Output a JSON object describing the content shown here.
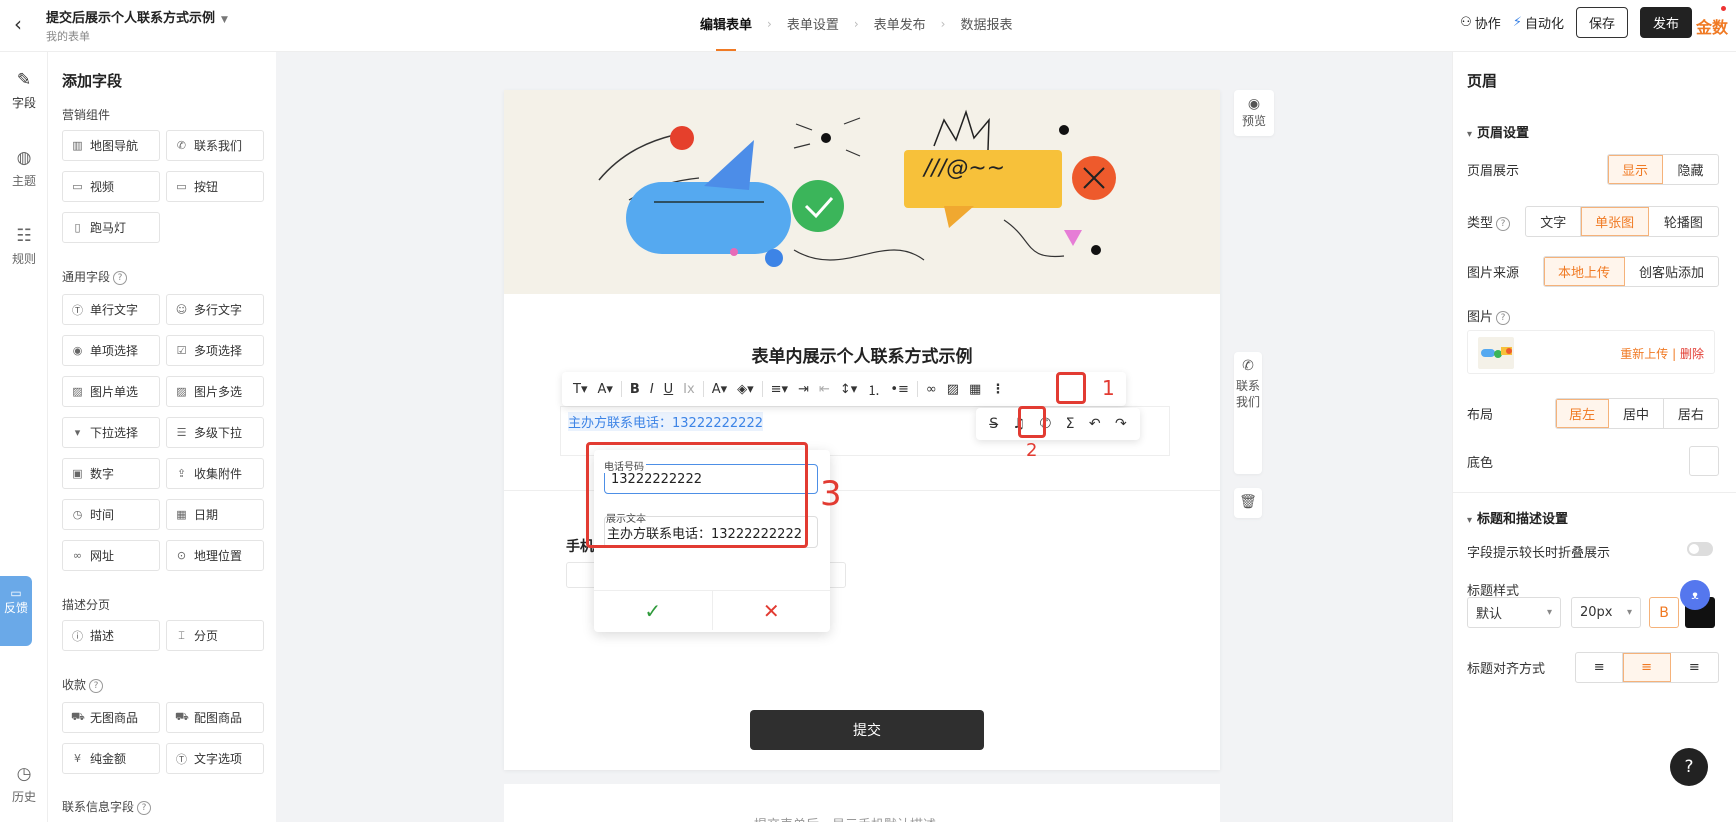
{
  "header": {
    "title": "提交后展示个人联系方式示例",
    "subtitle": "我的表单",
    "steps": [
      "编辑表单",
      "表单设置",
      "表单发布",
      "数据报表"
    ],
    "collab": "协作",
    "automation": "自动化",
    "save": "保存",
    "publish": "发布",
    "brand": "金数"
  },
  "left_nav": {
    "fields": "字段",
    "theme": "主题",
    "rules": "规则",
    "history": "历史",
    "feedback": "反馈"
  },
  "field_panel": {
    "title": "添加字段",
    "groups": [
      {
        "name": "营销组件",
        "items": [
          {
            "icon": "map-icon",
            "label": "地图导航"
          },
          {
            "icon": "phone-icon",
            "label": "联系我们"
          },
          {
            "icon": "video-icon",
            "label": "视频"
          },
          {
            "icon": "button-icon",
            "label": "按钮"
          },
          {
            "icon": "marquee-icon",
            "label": "跑马灯"
          }
        ]
      },
      {
        "name": "通用字段",
        "items": [
          {
            "icon": "text-icon",
            "label": "单行文字"
          },
          {
            "icon": "comment-icon",
            "label": "多行文字"
          },
          {
            "icon": "radio-icon",
            "label": "单项选择"
          },
          {
            "icon": "checkbox-icon",
            "label": "多项选择"
          },
          {
            "icon": "image-icon",
            "label": "图片单选"
          },
          {
            "icon": "images-icon",
            "label": "图片多选"
          },
          {
            "icon": "dropdown-icon",
            "label": "下拉选择"
          },
          {
            "icon": "multi-dropdown-icon",
            "label": "多级下拉"
          },
          {
            "icon": "number-icon",
            "label": "数字"
          },
          {
            "icon": "upload-icon",
            "label": "收集附件"
          },
          {
            "icon": "clock-icon",
            "label": "时间"
          },
          {
            "icon": "calendar-icon",
            "label": "日期"
          },
          {
            "icon": "link-icon",
            "label": "网址"
          },
          {
            "icon": "location-icon",
            "label": "地理位置"
          }
        ]
      },
      {
        "name": "描述分页",
        "items": [
          {
            "icon": "info-icon",
            "label": "描述"
          },
          {
            "icon": "pagebreak-icon",
            "label": "分页"
          }
        ]
      },
      {
        "name": "收款",
        "items": [
          {
            "icon": "cart-icon",
            "label": "无图商品"
          },
          {
            "icon": "cart-image-icon",
            "label": "配图商品"
          },
          {
            "icon": "yuan-icon",
            "label": "纯金额"
          },
          {
            "icon": "text-option-icon",
            "label": "文字选项"
          }
        ]
      },
      {
        "name": "联系信息字段",
        "items": []
      }
    ]
  },
  "canvas": {
    "form_title": "表单内展示个人联系方式示例",
    "phone_link_text": "主办方联系电话：13222222222",
    "annotations": [
      "1",
      "2",
      "3"
    ],
    "popup": {
      "phone_label": "电话号码",
      "phone_value": "13222222222",
      "display_label": "展示文本",
      "display_value": "主办方联系电话：13222222222"
    },
    "field_label_partial": "手机",
    "submit": "提交",
    "preview": "预览",
    "contact_us_vertical": "联系我们",
    "card2_text": "提交表单后，显示手机默认描述"
  },
  "right_panel": {
    "title": "页眉",
    "section_header": "页眉设置",
    "display_label": "页眉展示",
    "display_options": [
      "显示",
      "隐藏"
    ],
    "type_label": "类型",
    "type_options": [
      "文字",
      "单张图",
      "轮播图"
    ],
    "source_label": "图片来源",
    "source_options": [
      "本地上传",
      "创客贴添加"
    ],
    "image_label": "图片",
    "reupload": "重新上传",
    "delete": "删除",
    "layout_label": "布局",
    "layout_options": [
      "居左",
      "居中",
      "居右"
    ],
    "bgcolor_label": "底色",
    "section_title_desc": "标题和描述设置",
    "collapse_label": "字段提示较长时折叠展示",
    "title_style_label": "标题样式",
    "style_value": "默认",
    "size_value": "20px",
    "bold": "B",
    "align_label": "标题对齐方式"
  },
  "colors": {
    "accent": "#f07a24",
    "annotation_red": "#e23b32",
    "link_blue": "#3d84e6",
    "dark": "#222222"
  }
}
